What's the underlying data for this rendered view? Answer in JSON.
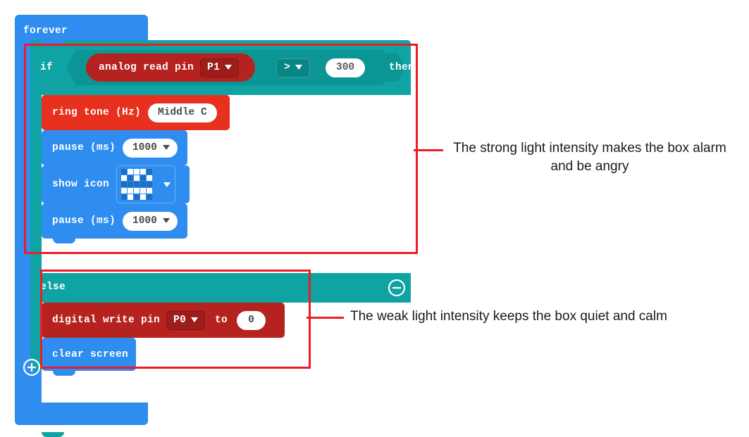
{
  "program": {
    "forever": {
      "label": "forever"
    },
    "if_block": {
      "if_label": "if",
      "then_label": "then",
      "else_label": "else",
      "collapse_icon": "minus-circle-icon",
      "add_icon": "plus-circle-icon",
      "condition": {
        "reporter_label": "analog read pin",
        "pin_value": "P1",
        "pin_caret": "chevron-down-icon",
        "operator": ">",
        "operator_caret": "chevron-down-icon",
        "compare_value": "300"
      }
    },
    "then_branch": [
      {
        "kind": "ring-tone",
        "label": "ring tone (Hz)",
        "value": "Middle C"
      },
      {
        "kind": "pause",
        "label": "pause (ms)",
        "value": "1000",
        "caret": "chevron-down-icon"
      },
      {
        "kind": "show-icon",
        "label": "show icon",
        "value": "angry-face-led-icon",
        "caret": "chevron-down-icon",
        "led_matrix": [
          [
            0,
            1,
            1,
            1,
            0
          ],
          [
            1,
            0,
            1,
            0,
            1
          ],
          [
            0,
            0,
            0,
            0,
            0
          ],
          [
            1,
            1,
            1,
            1,
            1
          ],
          [
            0,
            1,
            0,
            1,
            0
          ]
        ]
      },
      {
        "kind": "pause",
        "label": "pause (ms)",
        "value": "1000",
        "caret": "chevron-down-icon"
      }
    ],
    "else_branch": [
      {
        "kind": "digital-write",
        "label": "digital write pin",
        "pin_value": "P0",
        "pin_caret": "chevron-down-icon",
        "to_label": "to",
        "value": "0"
      },
      {
        "kind": "clear-screen",
        "label": "clear screen"
      }
    ]
  },
  "annotations": [
    {
      "id": "strong",
      "text": "The strong light intensity makes the box alarm and be angry"
    },
    {
      "id": "weak",
      "text": "The weak light intensity keeps the box quiet and calm"
    }
  ],
  "colors": {
    "loop_blue": "#2E8DEF",
    "logic_teal": "#0FA3A3",
    "pins_dark_red": "#B5221F",
    "music_red": "#E8301E",
    "annotation_red": "#ED1C24",
    "led_off": "#1C6FC4",
    "led_on": "#FFFFFF"
  }
}
